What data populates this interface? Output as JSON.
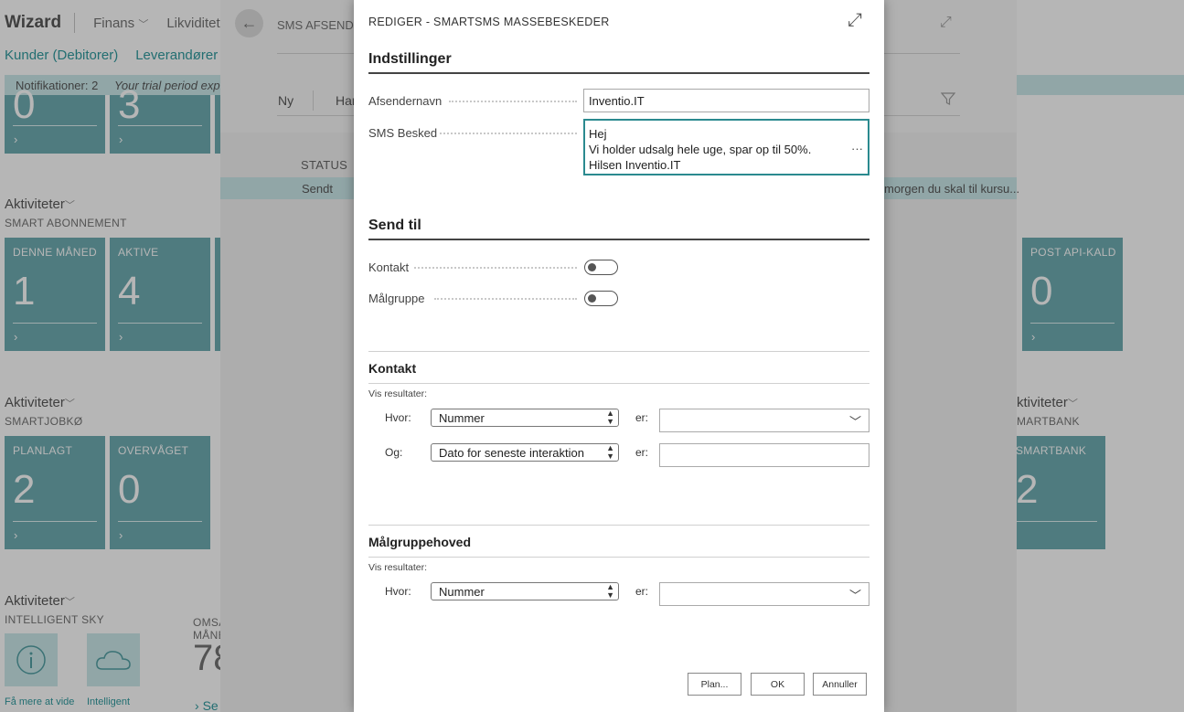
{
  "background": {
    "app_name": "Wizard",
    "menus": [
      "Finans",
      "Likviditet"
    ],
    "subnav": [
      "Kunder (Debitorer)",
      "Leverandører (K"
    ],
    "notification": {
      "label": "Notifikationer: 2",
      "trial": "Your trial period expi"
    },
    "top_tiles": [
      {
        "value": "0"
      },
      {
        "value": "3"
      }
    ],
    "sections": [
      {
        "title": "Aktiviteter",
        "subtitle": "SMART ABONNEMENT"
      },
      {
        "title": "Aktiviteter",
        "subtitle": "SMARTJOBKØ"
      },
      {
        "title": "Aktiviteter",
        "subtitle": "INTELLIGENT SKY"
      },
      {
        "title": "ktiviteter",
        "subtitle": "MARTBANK"
      }
    ],
    "abonnement_tiles": [
      {
        "label": "DENNE MÅNED",
        "value": "1"
      },
      {
        "label": "AKTIVE",
        "value": "4"
      },
      {
        "label": "POST API-KALD",
        "value": "0"
      }
    ],
    "jobko_tiles": [
      {
        "label": "PLANLAGT",
        "value": "2"
      },
      {
        "label": "OVERVÅGET",
        "value": "0"
      },
      {
        "label": "SMARTBANK",
        "value": "2"
      }
    ],
    "sky": {
      "items": [
        "Få mere at vide",
        "Intelligent"
      ],
      "omsa_label": "OMSA MÅNE",
      "omsa_value": "78",
      "see_more": "Se"
    }
  },
  "list_page": {
    "title": "SMS AFSENDT,",
    "actions": {
      "new": "Ny",
      "han": "Har"
    },
    "column_status": "STATUS",
    "row": {
      "status": "Sendt",
      "message": "morgen du skal til kursu..."
    }
  },
  "dialog": {
    "title": "REDIGER - SMARTSMS MASSEBESKEDER",
    "settings_group": "Indstillinger",
    "sender_label": "Afsendernavn",
    "sender_value": "Inventio.IT",
    "message_label": "SMS Besked",
    "message_lines": [
      "Hej",
      "Vi holder udsalg hele uge, spar op til 50%.",
      "Hilsen Inventio.IT"
    ],
    "sendto_group": "Send til",
    "contact_toggle_label": "Kontakt",
    "target_toggle_label": "Målgruppe",
    "contact_section": {
      "title": "Kontakt",
      "show_results": "Vis resultater:",
      "rows": [
        {
          "label": "Hvor:",
          "field": "Nummer",
          "er": "er:",
          "value": "",
          "dropdown": true
        },
        {
          "label": "Og:",
          "field": "Dato for seneste interaktion",
          "er": "er:",
          "value": "",
          "dropdown": false
        }
      ]
    },
    "target_section": {
      "title": "Målgruppehoved",
      "show_results": "Vis resultater:",
      "rows": [
        {
          "label": "Hvor:",
          "field": "Nummer",
          "er": "er:",
          "value": "",
          "dropdown": true
        }
      ]
    },
    "buttons": {
      "plan": "Plan...",
      "ok": "OK",
      "cancel": "Annuller"
    }
  }
}
